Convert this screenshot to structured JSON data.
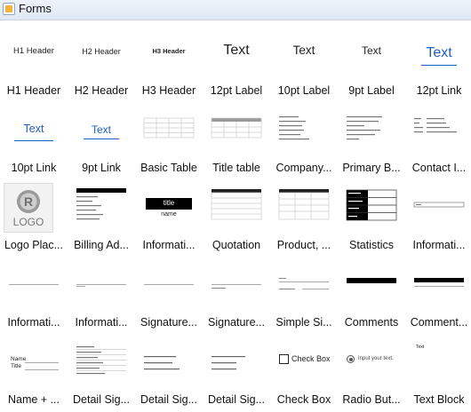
{
  "window": {
    "title": "Forms"
  },
  "items": [
    {
      "label": "H1 Header",
      "preview": "H1 Header"
    },
    {
      "label": "H2 Header",
      "preview": "H2 Header"
    },
    {
      "label": "H3 Header",
      "preview": "H3 Header"
    },
    {
      "label": "12pt Label",
      "preview": "Text"
    },
    {
      "label": "10pt Label",
      "preview": "Text"
    },
    {
      "label": "9pt Label",
      "preview": "Text"
    },
    {
      "label": "12pt Link",
      "preview": "Text"
    },
    {
      "label": "10pt Link",
      "preview": "Text"
    },
    {
      "label": "9pt Link",
      "preview": "Text"
    },
    {
      "label": "Basic Table"
    },
    {
      "label": "Title table"
    },
    {
      "label": "Company..."
    },
    {
      "label": "Primary B..."
    },
    {
      "label": "Contact I..."
    },
    {
      "label": "Logo Plac...",
      "preview": "LOGO"
    },
    {
      "label": "Billing Ad..."
    },
    {
      "label": "Informati...",
      "preview": "title",
      "preview2": "name"
    },
    {
      "label": "Quotation"
    },
    {
      "label": "Product, ..."
    },
    {
      "label": "Statistics"
    },
    {
      "label": "Informati..."
    },
    {
      "label": "Informati..."
    },
    {
      "label": "Informati..."
    },
    {
      "label": "Signature..."
    },
    {
      "label": "Signature..."
    },
    {
      "label": "Simple Si..."
    },
    {
      "label": "Comments"
    },
    {
      "label": "Comment..."
    },
    {
      "label": "Name + ...",
      "preview": "Name",
      "preview2": "Title"
    },
    {
      "label": "Detail Sig..."
    },
    {
      "label": "Detail Sig..."
    },
    {
      "label": "Detail Sig..."
    },
    {
      "label": "Check Box",
      "preview": "Check Box"
    },
    {
      "label": "Radio But...",
      "preview": "Input your text."
    },
    {
      "label": "Text Block",
      "preview": "Text"
    }
  ]
}
